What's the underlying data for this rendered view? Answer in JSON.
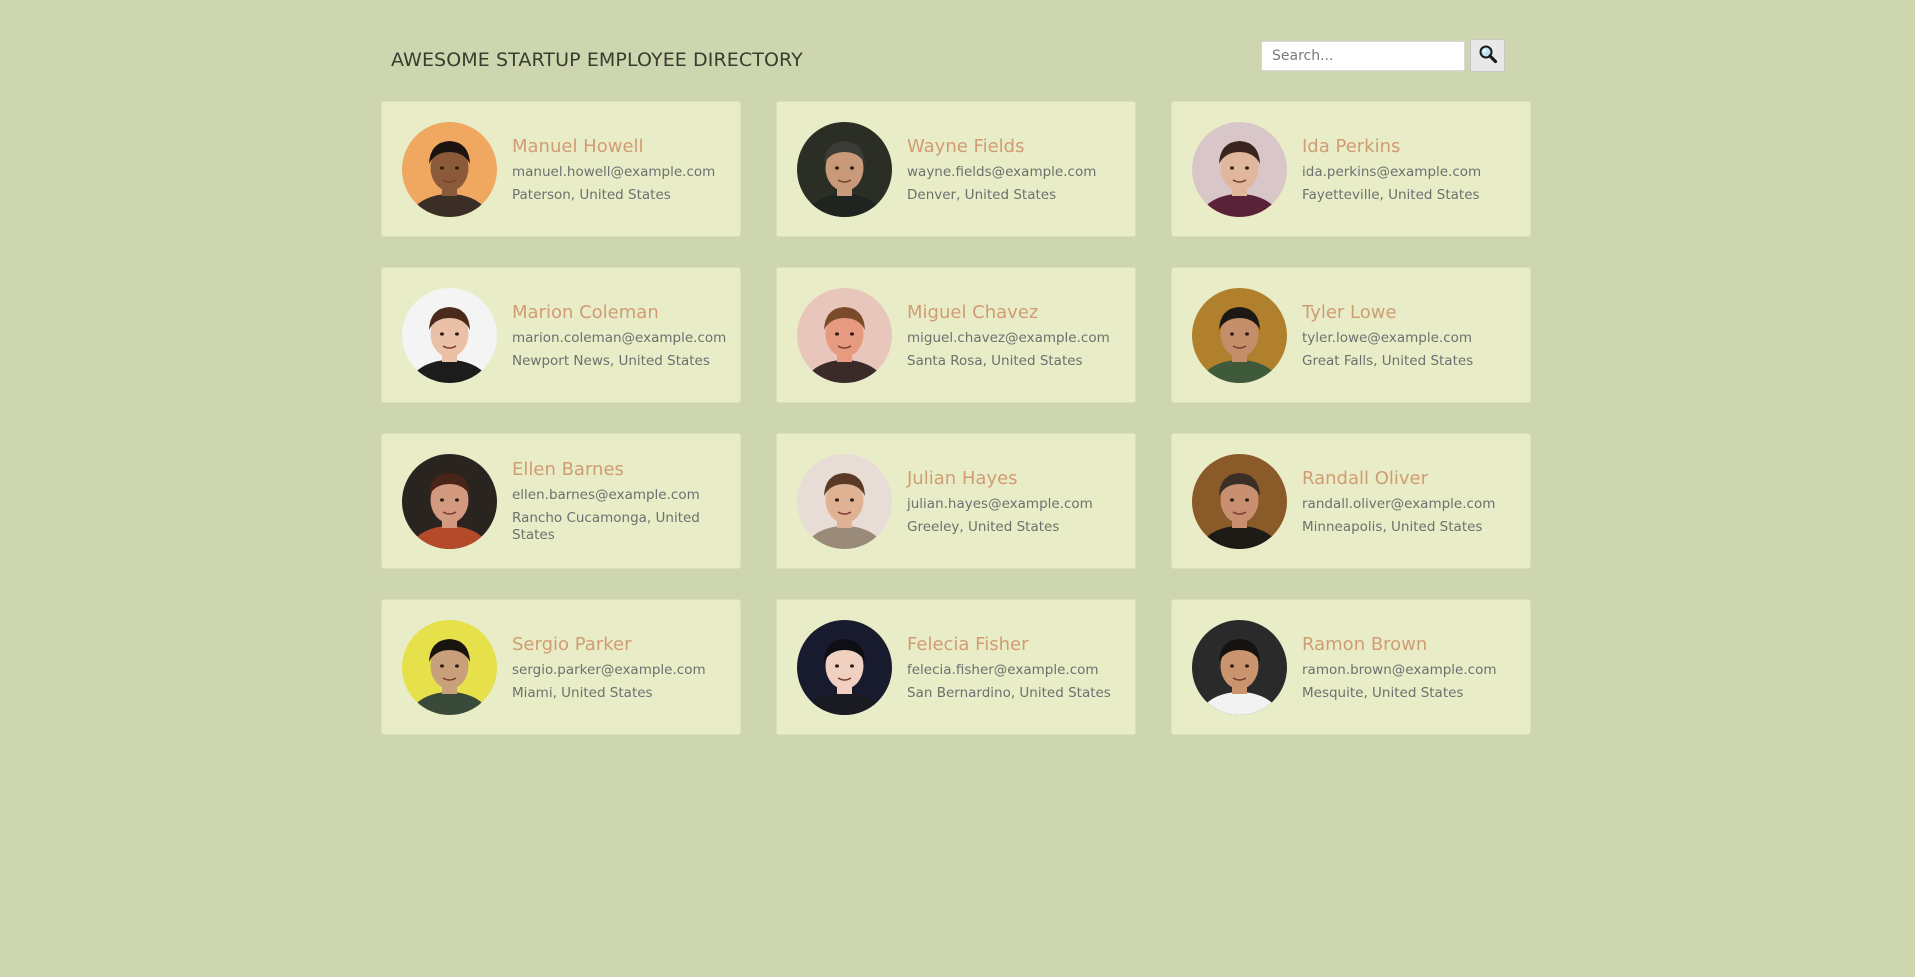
{
  "header": {
    "title": "AWESOME STARTUP EMPLOYEE DIRECTORY",
    "search_placeholder": "Search...",
    "search_icon": "magnifying-glass-icon"
  },
  "colors": {
    "background": "#ced6b0",
    "card": "#e9edc7",
    "name": "#d09c74",
    "text": "#6f6f6f"
  },
  "employees": [
    {
      "name": "Manuel Howell",
      "email": "manuel.howell@example.com",
      "location": "Paterson, United States",
      "avatar_bg": "#f0a860",
      "avatar_skin": "#8a5a3a",
      "avatar_hair": "#1b1410",
      "avatar_shirt": "#3b2e26"
    },
    {
      "name": "Wayne Fields",
      "email": "wayne.fields@example.com",
      "location": "Denver, United States",
      "avatar_bg": "#2b2e24",
      "avatar_skin": "#c99a7a",
      "avatar_hair": "#3a3a36",
      "avatar_shirt": "#1f2420"
    },
    {
      "name": "Ida Perkins",
      "email": "ida.perkins@example.com",
      "location": "Fayetteville, United States",
      "avatar_bg": "#d8c6c8",
      "avatar_skin": "#e0b69c",
      "avatar_hair": "#3a2420",
      "avatar_shirt": "#5a2238"
    },
    {
      "name": "Marion Coleman",
      "email": "marion.coleman@example.com",
      "location": "Newport News, United States",
      "avatar_bg": "#f4f4f4",
      "avatar_skin": "#eac0a6",
      "avatar_hair": "#4a2a1c",
      "avatar_shirt": "#1c1c1c"
    },
    {
      "name": "Miguel Chavez",
      "email": "miguel.chavez@example.com",
      "location": "Santa Rosa, United States",
      "avatar_bg": "#e9c6bc",
      "avatar_skin": "#e69a80",
      "avatar_hair": "#7a4a2a",
      "avatar_shirt": "#3a2a28"
    },
    {
      "name": "Tyler Lowe",
      "email": "tyler.lowe@example.com",
      "location": "Great Falls, United States",
      "avatar_bg": "#b0802c",
      "avatar_skin": "#c48e6a",
      "avatar_hair": "#1c1814",
      "avatar_shirt": "#3e5a3a"
    },
    {
      "name": "Ellen Barnes",
      "email": "ellen.barnes@example.com",
      "location": "Rancho Cucamonga, United States",
      "avatar_bg": "#2a2420",
      "avatar_skin": "#d49a80",
      "avatar_hair": "#4a2418",
      "avatar_shirt": "#b44a2a"
    },
    {
      "name": "Julian Hayes",
      "email": "julian.hayes@example.com",
      "location": "Greeley, United States",
      "avatar_bg": "#e8dcd6",
      "avatar_skin": "#e0b294",
      "avatar_hair": "#5a3a26",
      "avatar_shirt": "#9a8a7a"
    },
    {
      "name": "Randall Oliver",
      "email": "randall.oliver@example.com",
      "location": "Minneapolis, United States",
      "avatar_bg": "#8a5a28",
      "avatar_skin": "#c89070",
      "avatar_hair": "#3a2e26",
      "avatar_shirt": "#1e1a16"
    },
    {
      "name": "Sergio Parker",
      "email": "sergio.parker@example.com",
      "location": "Miami, United States",
      "avatar_bg": "#e6e04a",
      "avatar_skin": "#c8a07c",
      "avatar_hair": "#1a1410",
      "avatar_shirt": "#3a4a3a"
    },
    {
      "name": "Felecia Fisher",
      "email": "felecia.fisher@example.com",
      "location": "San Bernardino, United States",
      "avatar_bg": "#181a2e",
      "avatar_skin": "#f0d0c0",
      "avatar_hair": "#0e0e14",
      "avatar_shirt": "#1a1a22"
    },
    {
      "name": "Ramon Brown",
      "email": "ramon.brown@example.com",
      "location": "Mesquite, United States",
      "avatar_bg": "#2a2a2a",
      "avatar_skin": "#c9946e",
      "avatar_hair": "#161210",
      "avatar_shirt": "#f2f2f2"
    }
  ]
}
